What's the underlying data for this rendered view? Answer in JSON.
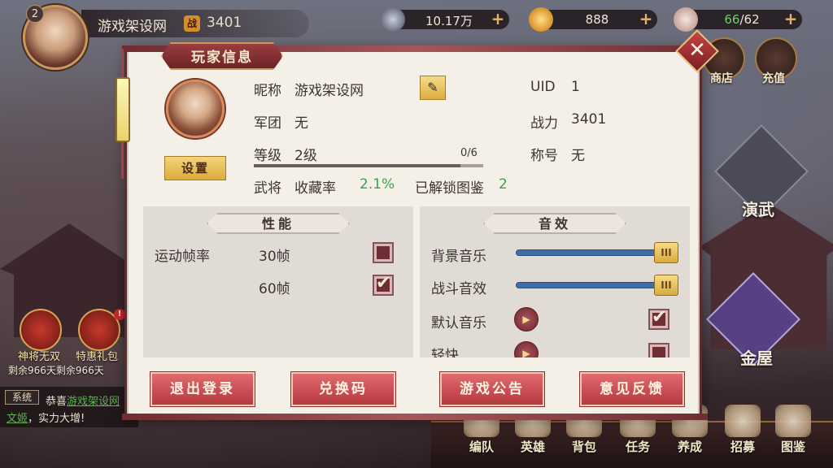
{
  "hud": {
    "level": "2",
    "player_name": "游戏架设网",
    "power_icon_text": "战",
    "power": "3401",
    "silver": "10.17万",
    "gold": "888",
    "stamina_current": "66",
    "stamina_max": "/62",
    "plus": "+",
    "shop_label": "商店",
    "recharge_label": "充值",
    "train_label": "演武",
    "golden_house_label": "金屋",
    "gift1_label": "神将无双",
    "gift2_label": "特惠礼包",
    "gift_remaining": "剩余966天剩余966天",
    "alert_mark": "!"
  },
  "chat": {
    "tag": "系统",
    "prefix": "恭喜",
    "link1": "游戏架设网",
    "link2": "文姬",
    "suffix": "，实力大增!"
  },
  "bottom_nav": [
    "编队",
    "英雄",
    "背包",
    "任务",
    "养成",
    "招募",
    "图鉴"
  ],
  "dialog": {
    "title": "玩家信息",
    "close_glyph": "✕",
    "set_button": "设置",
    "nickname_label": "昵称",
    "nickname": "游戏架设网",
    "edit_glyph": "✎",
    "uid_label": "UID",
    "uid": "1",
    "legion_label": "军团",
    "legion": "无",
    "power_label": "战力",
    "power": "3401",
    "level_label": "等级",
    "level": "2级",
    "xp_text": "0/6",
    "xp_fraction": 0.9,
    "title_label": "称号",
    "title_value": "无",
    "generals_label": "武将",
    "collection_label": "收藏率",
    "collection_rate": "2.1%",
    "unlocked_label": "已解锁图鉴",
    "unlocked_count": "2"
  },
  "performance": {
    "section_title": "性能",
    "fps_label": "运动帧率",
    "options": [
      {
        "label": "30帧",
        "checked": false
      },
      {
        "label": "60帧",
        "checked": true
      }
    ]
  },
  "sound": {
    "section_title": "音效",
    "bgm_label": "背景音乐",
    "bgm_level": 1.0,
    "sfx_label": "战斗音效",
    "sfx_level": 1.0,
    "knob_glyph": "III",
    "play_glyph": "▶",
    "tick_glyph": "✔",
    "music": [
      {
        "label": "默认音乐",
        "checked": true
      },
      {
        "label": "轻快",
        "checked": false
      }
    ]
  },
  "actions": {
    "logout": "退出登录",
    "redeem": "兑换码",
    "notice": "游戏公告",
    "feedback": "意见反馈"
  }
}
